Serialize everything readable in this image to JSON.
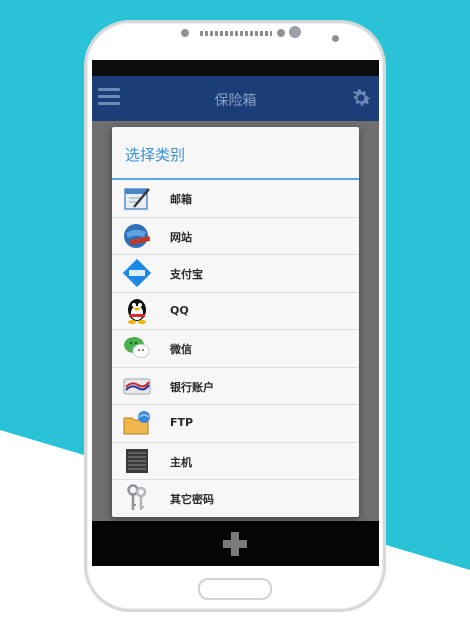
{
  "colors": {
    "teal": "#29c2d6",
    "appbar": "#1b3e78",
    "accent": "#3d8fd4"
  },
  "appbar": {
    "title": "保险箱",
    "menu_icon": "hamburger-menu-icon",
    "settings_icon": "gear-icon"
  },
  "dialog": {
    "title": "选择类别",
    "items": [
      {
        "label": "邮箱",
        "icon": "mail-icon"
      },
      {
        "label": "网站",
        "icon": "globe-icon"
      },
      {
        "label": "支付宝",
        "icon": "alipay-icon"
      },
      {
        "label": "QQ",
        "icon": "qq-penguin-icon"
      },
      {
        "label": "微信",
        "icon": "wechat-icon"
      },
      {
        "label": "银行账户",
        "icon": "bank-card-icon"
      },
      {
        "label": "FTP",
        "icon": "ftp-folder-icon"
      },
      {
        "label": "主机",
        "icon": "server-icon"
      },
      {
        "label": "其它密码",
        "icon": "keys-icon"
      }
    ]
  },
  "bottombar": {
    "add_icon": "plus-icon"
  }
}
